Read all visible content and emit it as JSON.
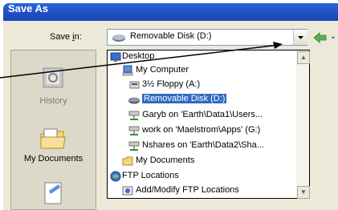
{
  "title": "Save As",
  "save_in": {
    "label_prefix": "Save ",
    "label_underlined": "i",
    "label_suffix": "n:",
    "selected": "Removable Disk (D:)"
  },
  "places": [
    {
      "label": "History",
      "icon": "history-icon"
    },
    {
      "label": "My Documents",
      "icon": "my-documents-icon"
    }
  ],
  "dropdown": {
    "items": [
      {
        "label": "Desktop",
        "icon": "desktop-icon",
        "indent": 0
      },
      {
        "label": "My Computer",
        "icon": "my-computer-icon",
        "indent": 1
      },
      {
        "label": "3½ Floppy (A:)",
        "icon": "floppy-icon",
        "indent": 2
      },
      {
        "label": "Removable Disk (D:)",
        "icon": "removable-disk-icon",
        "indent": 2,
        "selected": true
      },
      {
        "label": "Garyb on 'Earth\\Data1\\Users...",
        "icon": "network-drive-icon",
        "indent": 2
      },
      {
        "label": "work on 'Maelstrom\\Apps' (G:)",
        "icon": "network-drive-icon",
        "indent": 2
      },
      {
        "label": "Nshares on 'Earth\\Data2\\Sha...",
        "icon": "network-drive-icon",
        "indent": 2
      },
      {
        "label": "My Documents",
        "icon": "folder-icon",
        "indent": 1
      },
      {
        "label": "FTP Locations",
        "icon": "ftp-icon",
        "indent": 0
      },
      {
        "label": "Add/Modify FTP Locations",
        "icon": "ftp-add-icon",
        "indent": 1
      }
    ]
  },
  "colors": {
    "titlebar": "#1f4fc4",
    "selection": "#316ac5",
    "dialog_bg": "#ece9d8"
  }
}
